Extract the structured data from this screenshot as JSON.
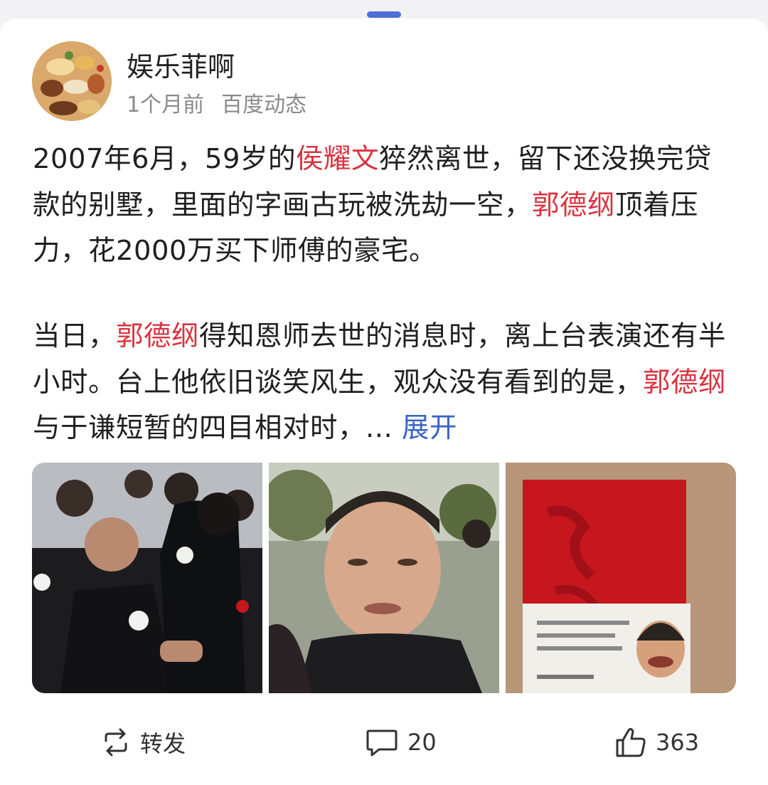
{
  "post": {
    "author": "娱乐菲啊",
    "time": "1个月前",
    "source": "百度动态",
    "paragraph1": [
      {
        "text": "2007年6月，59岁的",
        "hl": false
      },
      {
        "text": "侯耀文",
        "hl": true
      },
      {
        "text": "猝然离世，留下还没换完贷款的别墅，里面的字画古玩被洗劫一空，",
        "hl": false
      },
      {
        "text": "郭德纲",
        "hl": true
      },
      {
        "text": "顶着压力，花2000万买下师傅的豪宅。",
        "hl": false
      }
    ],
    "paragraph2": [
      {
        "text": "当日，",
        "hl": false
      },
      {
        "text": "郭德纲",
        "hl": true
      },
      {
        "text": "得知恩师去世的消息时，离上台表演还有半小时。台上他依旧谈笑风生，观众没有看到的是，",
        "hl": false
      },
      {
        "text": "郭德纲",
        "hl": true
      },
      {
        "text": "与于谦短暂的四目相对时，... ",
        "hl": false
      }
    ],
    "expand_label": "展开",
    "images": [
      {
        "icon": "funeral-crowd-photo"
      },
      {
        "icon": "crying-man-photo"
      },
      {
        "icon": "red-book-photo"
      }
    ]
  },
  "actions": {
    "repost_label": "转发",
    "comment_count": "20",
    "like_count": "363"
  },
  "colors": {
    "highlight": "#d9333f",
    "link": "#3a62c4",
    "handle": "#4f6fd6"
  }
}
